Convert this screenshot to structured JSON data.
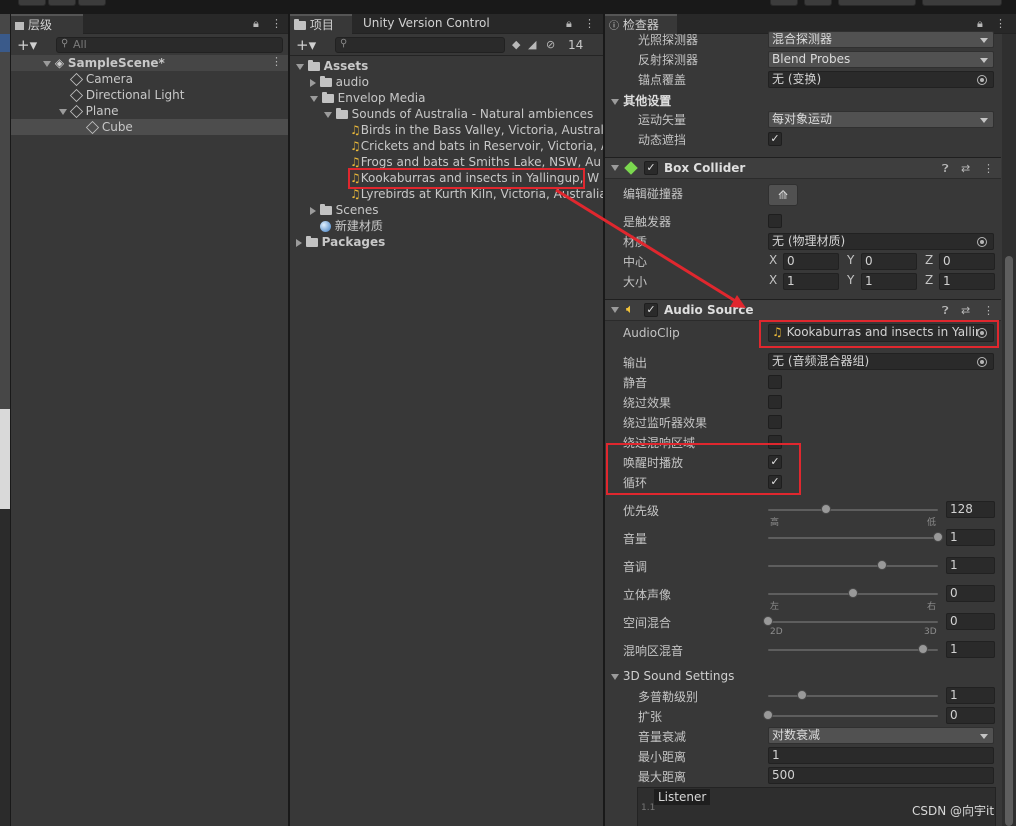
{
  "hierarchy": {
    "tab": "层级",
    "search_placeholder": "All",
    "scene": "SampleScene*",
    "items": [
      "Camera",
      "Directional Light",
      "Plane",
      "Cube"
    ]
  },
  "project": {
    "tab": "项目",
    "tab2": "Unity Version Control",
    "hidden_count": "14",
    "tree": [
      "Assets",
      "audio",
      "Envelop Media",
      "Sounds of Australia - Natural ambiences",
      "Birds in the Bass Valley, Victoria, Australia",
      "Crickets and bats in Reservoir, Victoria, A",
      "Frogs and bats at Smiths Lake, NSW, Au",
      "Kookaburras and insects in Yallingup, W",
      "Lyrebirds at Kurth Kiln, Victoria, Australia",
      "Scenes",
      "新建材质",
      "Packages"
    ]
  },
  "inspector": {
    "tab": "检查器",
    "top": {
      "light_probe_label": "光照探测器",
      "light_probe_value": "混合探测器",
      "reflection_label": "反射探测器",
      "reflection_value": "Blend Probes",
      "anchor_label": "锚点覆盖",
      "anchor_value": "无 (变换)"
    },
    "other": {
      "title": "其他设置",
      "motion_label": "运动矢量",
      "motion_value": "每对象运动",
      "occlusion_label": "动态遮挡",
      "occlusion_check": "✓"
    },
    "box": {
      "title": "Box Collider",
      "edit_label": "编辑碰撞器",
      "trigger_label": "是触发器",
      "material_label": "材质",
      "material_value": "无 (物理材质)",
      "center_label": "中心",
      "size_label": "大小",
      "x": "X",
      "y": "Y",
      "z": "Z",
      "center": [
        "0",
        "0",
        "0"
      ],
      "size": [
        "1",
        "1",
        "1"
      ]
    },
    "audio": {
      "title": "Audio Source",
      "clip_label": "AudioClip",
      "clip_value": "Kookaburras and insects in Yallin",
      "output_label": "输出",
      "output_value": "无 (音频混合器组)",
      "mute": "静音",
      "bypass_effects": "绕过效果",
      "bypass_listener": "绕过监听器效果",
      "bypass_reverb": "绕过混响区域",
      "play_on_awake": "唤醒时播放",
      "loop": "循环",
      "check": "✓",
      "priority_label": "优先级",
      "priority_value": "128",
      "priority_high": "高",
      "priority_low": "低",
      "priority_level": 0.34,
      "volume_label": "音量",
      "volume_value": "1",
      "volume_level": 1.0,
      "pitch_label": "音调",
      "pitch_value": "1",
      "pitch_level": 0.67,
      "stereo_label": "立体声像",
      "stereo_value": "0",
      "stereo_left": "左",
      "stereo_right": "右",
      "stereo_level": 0.5,
      "spatial_label": "空间混合",
      "spatial_value": "0",
      "spatial_2d": "2D",
      "spatial_3d": "3D",
      "spatial_level": 0.0,
      "reverb_label": "混响区混音",
      "reverb_value": "1",
      "reverb_level": 0.91
    },
    "sound3d": {
      "title": "3D Sound Settings",
      "doppler_label": "多普勒级别",
      "doppler_value": "1",
      "doppler_level": 0.2,
      "spread_label": "扩张",
      "spread_value": "0",
      "spread_level": 0.0,
      "rolloff_label": "音量衰减",
      "rolloff_value": "对数衰减",
      "min_label": "最小距离",
      "min_value": "1",
      "max_label": "最大距离",
      "max_value": "500",
      "listener": "Listener",
      "graph_tick": "1.1"
    }
  },
  "watermark": "CSDN @向宇it"
}
